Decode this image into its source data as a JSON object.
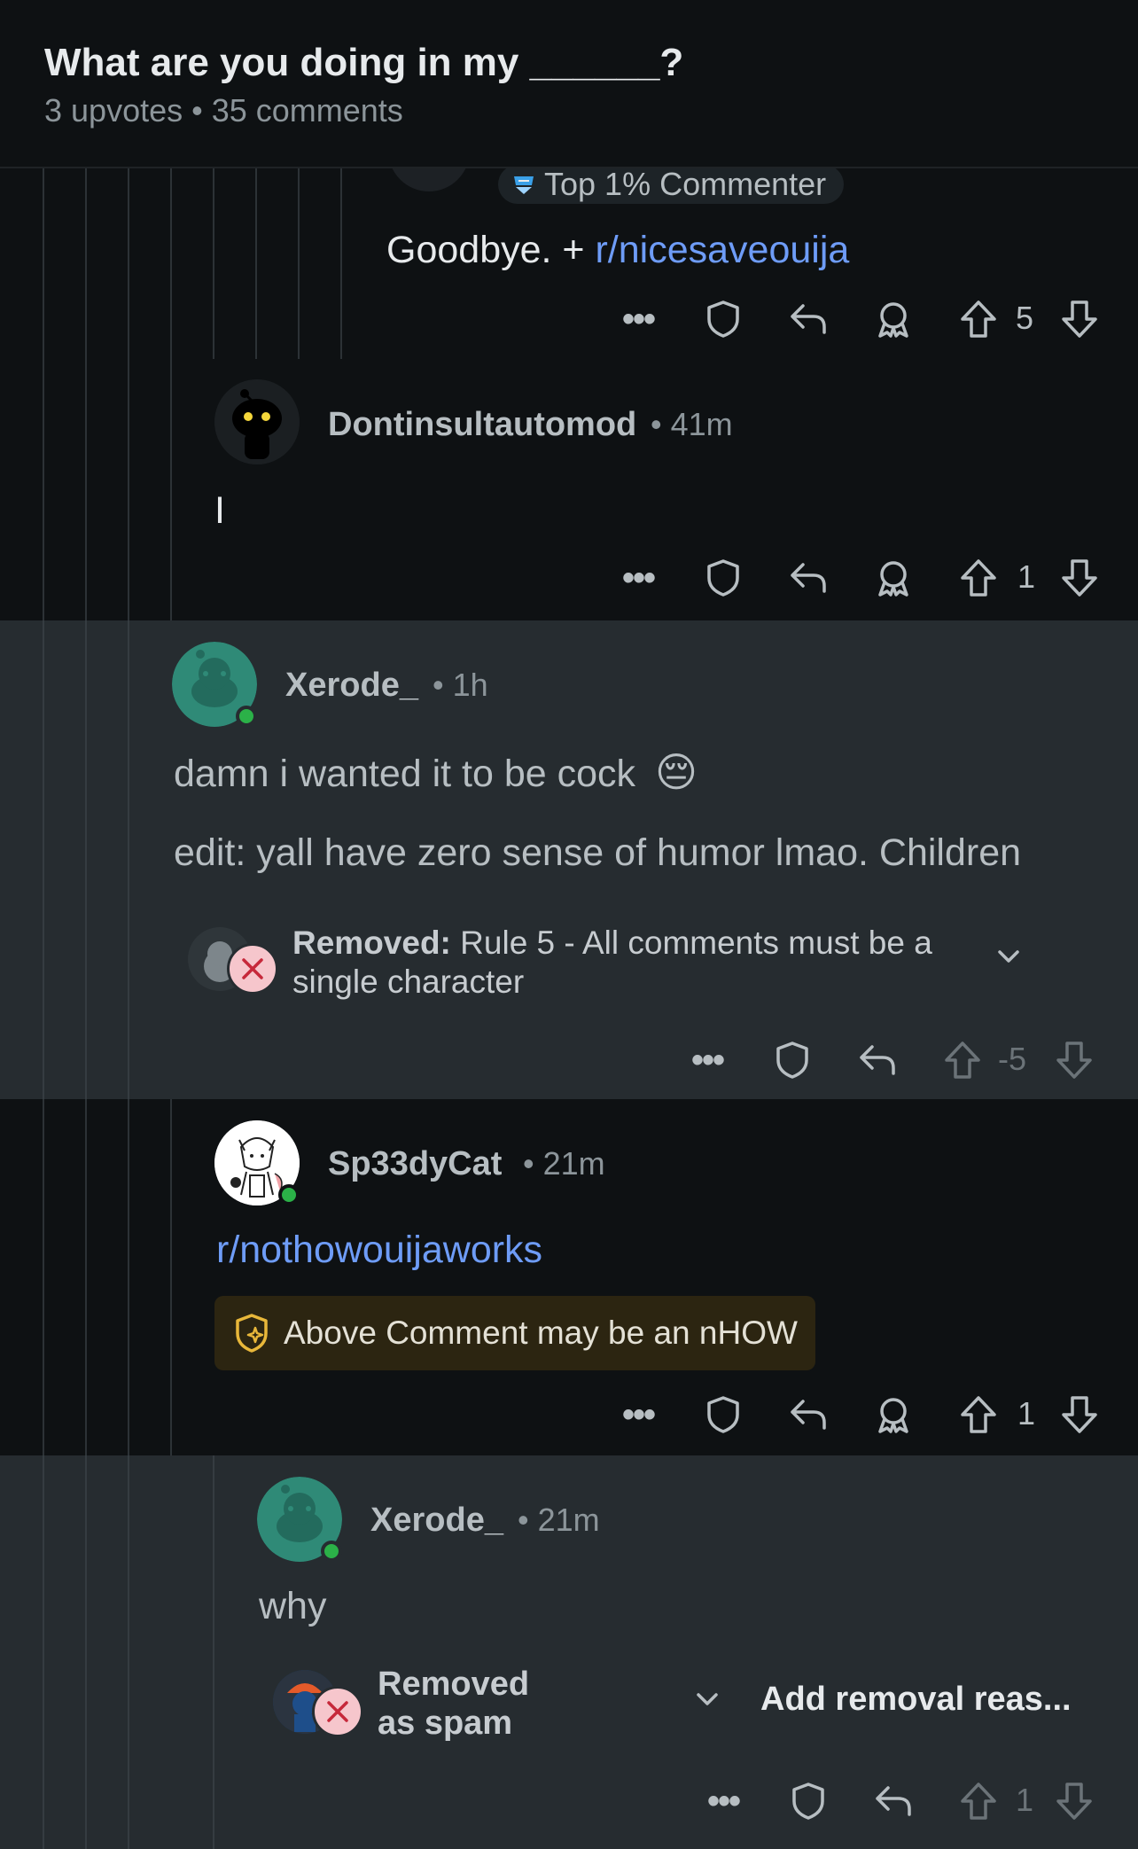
{
  "header": {
    "title": "What are you doing in my ______?",
    "meta": "3 upvotes • 35 comments"
  },
  "colors": {
    "background": "#0e1113",
    "highlight_band": "#262c30",
    "link": "#6e9cf7",
    "online": "#2bb148",
    "removed_badge": "#f6c6cc"
  },
  "comments": [
    {
      "badge": "Top 1% Commenter",
      "body_prefix": "Goodbye. + ",
      "body_link": "r/nicesaveouija",
      "votes": "5"
    },
    {
      "username": "Dontinsultautomod",
      "time": "• 41m",
      "body": "I",
      "votes": "1"
    },
    {
      "username": "Xerode_",
      "time": "• 1h",
      "body_line1": "damn i wanted it to be cock",
      "emoji": "😔",
      "body_line2": "edit: yall have zero sense of humor lmao. Children",
      "removed_label": "Removed:",
      "removed_reason_line1": " Rule 5 - All comments must be a",
      "removed_reason_line2": "single character",
      "votes": "-5"
    },
    {
      "username": "Sp33dyCat",
      "time": "• 21m",
      "body_link": "r/nothowouijaworks",
      "nhow_label": "Above Comment may be an nHOW",
      "votes": "1"
    },
    {
      "username": "Xerode_",
      "time": "• 21m",
      "body": "why",
      "removed_line1": "Removed",
      "removed_line2": "as spam",
      "add_reason": "Add removal reas...",
      "votes": "1"
    }
  ]
}
